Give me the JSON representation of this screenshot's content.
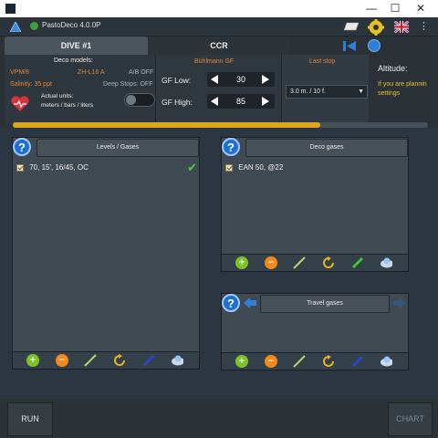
{
  "window": {
    "minimize": "—",
    "maximize": "☐",
    "close": "✕"
  },
  "appbar": {
    "title": "PastoDeco 4.0.0P"
  },
  "tabs": {
    "dive": "DIVE #1",
    "ccr": "CCR"
  },
  "deco_models": {
    "heading": "Deco models:",
    "model": "VPM/8",
    "algorithm": "ZH-L16 A",
    "ab": "A/B OFF",
    "salinity": "Salinity: 35 ppt",
    "deep_stops": "Deep Stops: OFF",
    "units_label": "Actual units:",
    "units_value": "meters / bars / liters"
  },
  "gf": {
    "heading": "Bühlmann GF",
    "low_label": "GF Low:",
    "low_value": "30",
    "high_label": "GF High:",
    "high_value": "85"
  },
  "last_stop": {
    "heading": "Last stop",
    "value": "3.0 m. / 10 f."
  },
  "altitude": {
    "label": "Altitude:",
    "hint_line1": "If you are plannin",
    "hint_line2": "settings"
  },
  "progress": 0.74,
  "levels": {
    "title": "Levels / Gases",
    "items": [
      "70, 15', 16/45, OC"
    ]
  },
  "deco": {
    "title": "Deco gases",
    "items": [
      "EAN 50, @22"
    ]
  },
  "travel": {
    "title": "Travel gases"
  },
  "buttons": {
    "run": "RUN",
    "chart": "CHART"
  },
  "colors": {
    "add": "#7cc32a",
    "remove": "#f08a1c",
    "refresh": "#e6b422",
    "progress_fill": "#e0a61a",
    "accent_orange": "#e2843a",
    "accent_yellow": "#e8c32c"
  }
}
